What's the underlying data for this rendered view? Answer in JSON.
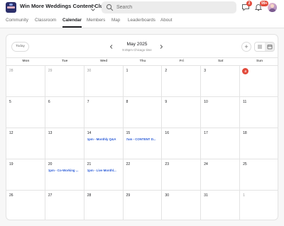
{
  "app": {
    "title": "Win More Weddings Content Club",
    "icons": {
      "logo": "community-logo",
      "switcher": "chevron-up-down-icon"
    }
  },
  "search": {
    "placeholder": "Search",
    "icon": "search-icon"
  },
  "top_actions": {
    "chat_badge": "2",
    "notifications_badge": "99+",
    "icons": [
      "chat-icon",
      "bell-icon",
      "avatar"
    ]
  },
  "nav": {
    "tabs": [
      {
        "label": "Community"
      },
      {
        "label": "Classroom"
      },
      {
        "label": "Calendar",
        "active": true
      },
      {
        "label": "Members"
      },
      {
        "label": "Map"
      },
      {
        "label": "Leaderboards"
      },
      {
        "label": "About"
      }
    ]
  },
  "calendar": {
    "today_label": "Today",
    "month": "May 2025",
    "timezone_note": "9:45pm Chicago time",
    "add_symbol": "+",
    "view_options": [
      "list-view-icon",
      "calendar-view-icon"
    ],
    "active_view": "calendar-view-icon",
    "weekdays": [
      "Mon",
      "Tue",
      "Wed",
      "Thu",
      "Fri",
      "Sat",
      "Sun"
    ],
    "weeks": [
      [
        {
          "day": "28",
          "muted": true
        },
        {
          "day": "29",
          "muted": true
        },
        {
          "day": "30",
          "muted": true
        },
        {
          "day": "1"
        },
        {
          "day": "2"
        },
        {
          "day": "3"
        },
        {
          "day": "4",
          "today": true
        }
      ],
      [
        {
          "day": "5"
        },
        {
          "day": "6"
        },
        {
          "day": "7"
        },
        {
          "day": "8"
        },
        {
          "day": "9"
        },
        {
          "day": "10"
        },
        {
          "day": "11"
        }
      ],
      [
        {
          "day": "12"
        },
        {
          "day": "13"
        },
        {
          "day": "14",
          "event": "1pm - Monthly Q&A"
        },
        {
          "day": "15",
          "event": "7am - CONTENT D..."
        },
        {
          "day": "16"
        },
        {
          "day": "17"
        },
        {
          "day": "18"
        }
      ],
      [
        {
          "day": "19"
        },
        {
          "day": "20",
          "event": "1pm - Co-Working ..."
        },
        {
          "day": "21",
          "event": "1pm - Live Monthl..."
        },
        {
          "day": "22"
        },
        {
          "day": "23"
        },
        {
          "day": "24"
        },
        {
          "day": "25"
        }
      ],
      [
        {
          "day": "26"
        },
        {
          "day": "27"
        },
        {
          "day": "28"
        },
        {
          "day": "29"
        },
        {
          "day": "30"
        },
        {
          "day": "31"
        },
        {
          "day": "1",
          "muted": true
        }
      ]
    ]
  },
  "colors": {
    "accent_event": "#2a5bd7",
    "badge": "#e24a3b",
    "today_marker": "#e24a3b",
    "page_background": "#f7f7f7"
  }
}
